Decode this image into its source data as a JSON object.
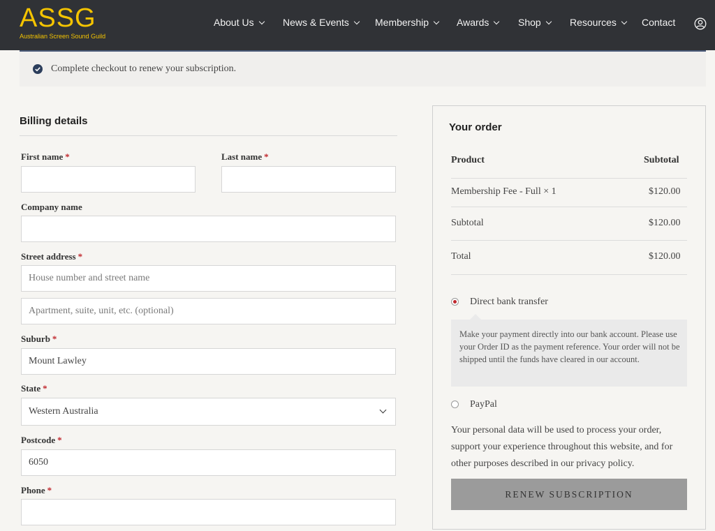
{
  "brand": {
    "name": "ASSG",
    "tagline": "Australian Screen Sound Guild",
    "color": "#f5c400"
  },
  "nav": {
    "items": [
      {
        "label": "About Us",
        "dropdown": true
      },
      {
        "label": "News & Events",
        "dropdown": true
      },
      {
        "label": "Membership",
        "dropdown": true
      },
      {
        "label": "Awards",
        "dropdown": true
      },
      {
        "label": "Shop",
        "dropdown": true
      },
      {
        "label": "Resources",
        "dropdown": true
      },
      {
        "label": "Contact",
        "dropdown": false
      }
    ],
    "account_icon": "user-circle-icon"
  },
  "notice": {
    "icon": "check-circle-icon",
    "text": "Complete checkout to renew your subscription."
  },
  "billing": {
    "title": "Billing details",
    "fields": {
      "first_name": {
        "label": "First name",
        "required": "*",
        "value": ""
      },
      "last_name": {
        "label": "Last name",
        "required": "*",
        "value": ""
      },
      "company": {
        "label": "Company name",
        "value": ""
      },
      "street": {
        "label": "Street address",
        "required": "*",
        "placeholder1": "House number and street name",
        "placeholder2": "Apartment, suite, unit, etc. (optional)"
      },
      "suburb": {
        "label": "Suburb",
        "required": "*",
        "value": "Mount Lawley"
      },
      "state": {
        "label": "State",
        "required": "*",
        "value": "Western Australia"
      },
      "postcode": {
        "label": "Postcode",
        "required": "*",
        "value": "6050"
      },
      "phone": {
        "label": "Phone",
        "required": "*",
        "value": ""
      }
    }
  },
  "order": {
    "title": "Your order",
    "headers": {
      "product": "Product",
      "subtotal": "Subtotal"
    },
    "item": {
      "name": "Membership Fee - Full × 1",
      "price": "$120.00"
    },
    "subtotal": {
      "label": "Subtotal",
      "value": "$120.00"
    },
    "total": {
      "label": "Total",
      "value": "$120.00"
    },
    "payment": {
      "bank": {
        "label": "Direct bank transfer",
        "selected": true,
        "description": "Make your payment directly into our bank account. Please use your Order ID as the payment reference. Your order will not be shipped until the funds have cleared in our account."
      },
      "paypal": {
        "label": "PayPal",
        "selected": false
      }
    },
    "privacy_text": "Your personal data will be used to process your order, support your experience throughout this website, and for other purposes described in our ",
    "privacy_link": "privacy policy",
    "privacy_end": ".",
    "button": "RENEW SUBSCRIPTION"
  },
  "colors": {
    "header_bg": "#303236",
    "required": "#c0272d",
    "button_bg": "#9b9b9b"
  }
}
